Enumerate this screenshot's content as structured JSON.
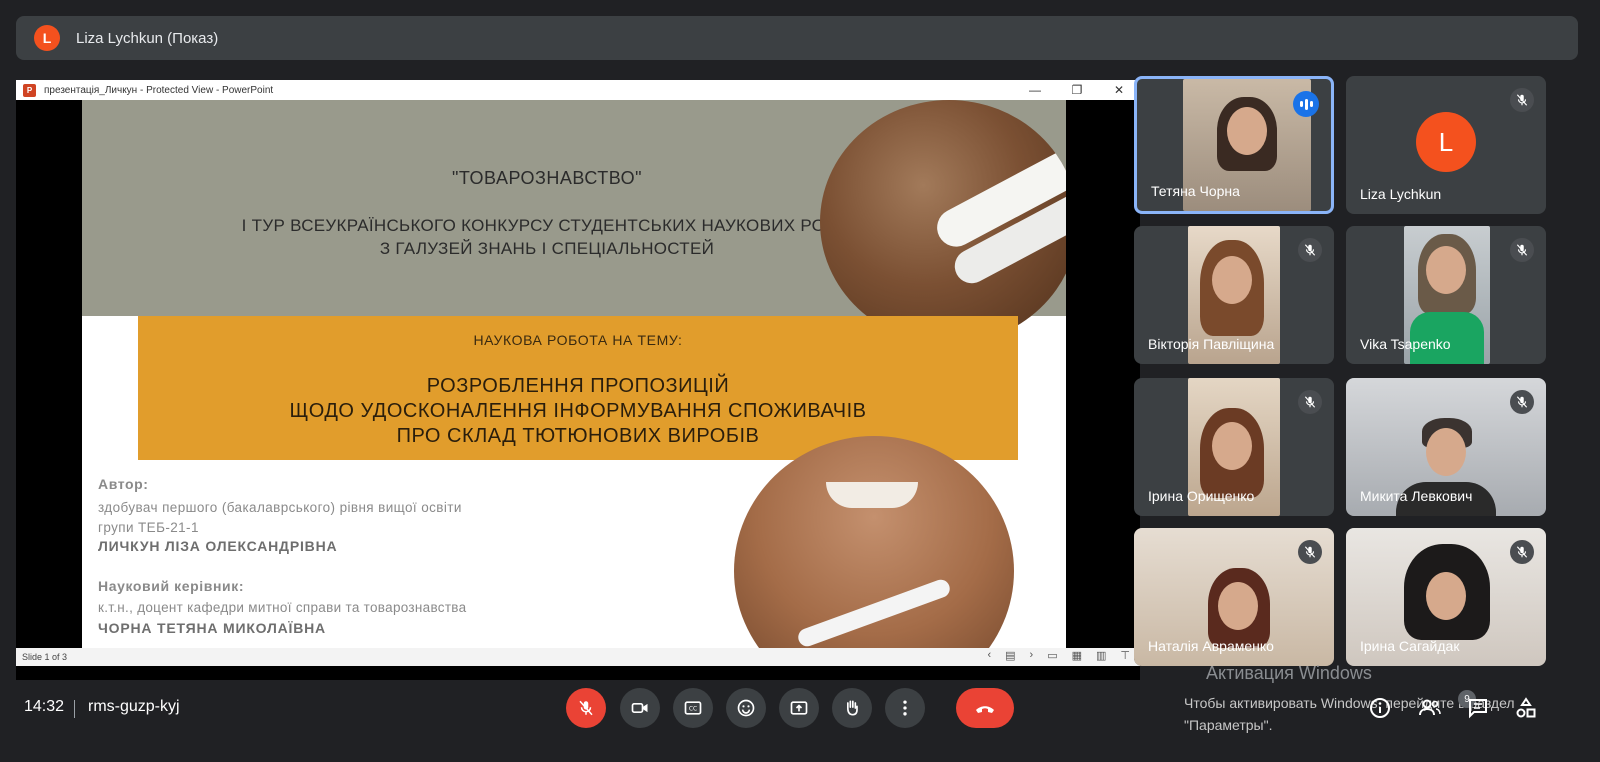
{
  "presenter_bar": {
    "initial": "L",
    "label": "Liza Lychkun (Показ)"
  },
  "ppt_window": {
    "title": "презентація_Личкун  -  Protected View - PowerPoint",
    "controls": [
      "—",
      "❐",
      "✕"
    ],
    "status": "Slide 1 of 3"
  },
  "slide": {
    "title": "\"ТОВАРОЗНАВСТВО\"",
    "subtitle_1": "І ТУР ВСЕУКРАЇНСЬКОГО КОНКУРСУ  СТУДЕНТСЬКИХ НАУКОВИХ РОБІТ",
    "subtitle_2": "З ГАЛУЗЕЙ ЗНАНЬ І СПЕЦІАЛЬНОСТЕЙ",
    "theme_label": "НАУКОВА РОБОТА НА ТЕМУ:",
    "theme_1": "РОЗРОБЛЕННЯ ПРОПОЗИЦІЙ",
    "theme_2": "ЩОДО УДОСКОНАЛЕННЯ ІНФОРМУВАННЯ СПОЖИВАЧІВ",
    "theme_3": "ПРО СКЛАД ТЮТЮНОВИХ ВИРОБІВ",
    "author_heading": "Автор:",
    "author_line_1": "здобувач першого (бакалаврського) рівня вищої освіти",
    "author_line_2": "групи ТЕБ-21-1",
    "author_name": "ЛИЧКУН ЛІЗА ОЛЕКСАНДРІВНА",
    "supervisor_heading": "Науковий керівник:",
    "supervisor_line": "к.т.н., доцент кафедри митної справи та товарознавства",
    "supervisor_name": "ЧОРНА ТЕТЯНА МИКОЛАЇВНА"
  },
  "participants": [
    {
      "name": "Тетяна Чорна",
      "speaking": true
    },
    {
      "name": "Liza Lychkun",
      "initial": "L"
    },
    {
      "name": "Вікторія Павліщина"
    },
    {
      "name": "Vika Tsapenko"
    },
    {
      "name": "Ірина Орищенко"
    },
    {
      "name": "Микита Левкович"
    },
    {
      "name": "Наталія Авраменко"
    },
    {
      "name": "Ірина Сагайдак"
    }
  ],
  "meeting": {
    "time": "14:32",
    "code": "rms-guzp-kyj",
    "participant_count": "9"
  },
  "watermark": {
    "title": "Активация Windows",
    "line_1": "Чтобы активировать Windows, перейдите в раздел",
    "line_2": "\"Параметры\"."
  },
  "colors": {
    "accent": "#8ab4f8",
    "end_call": "#ea4335",
    "slide_orange": "#e19d2c",
    "slide_gray": "#999a8c"
  }
}
